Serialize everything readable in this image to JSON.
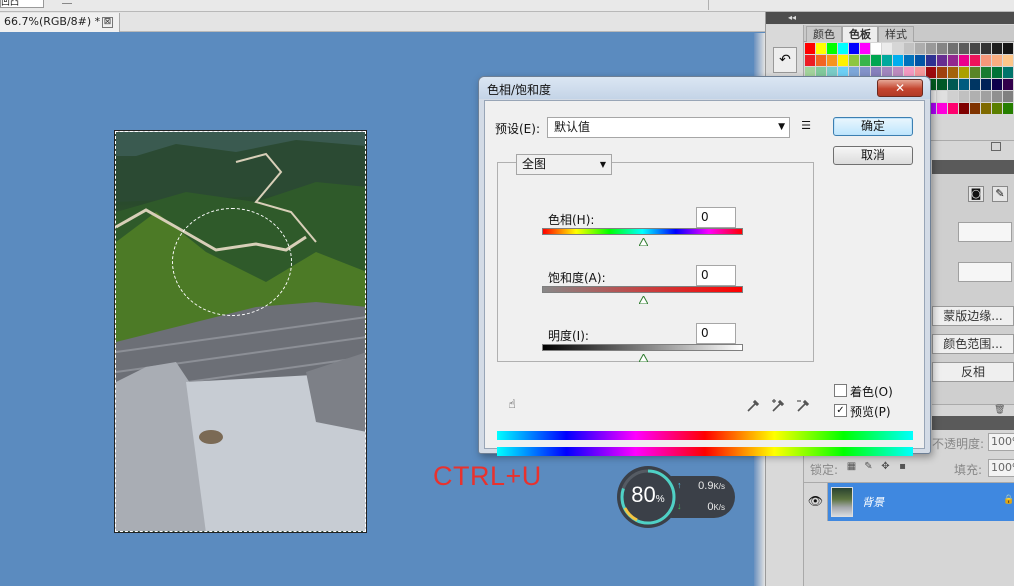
{
  "document_tab": {
    "title": "66.7%(RGB/8#) *",
    "close_glyph": "⊠",
    "top_fragment": "凹凸"
  },
  "annotation": {
    "text": "CTRL+U",
    "color": "#e8322e"
  },
  "network_widget": {
    "percent": "80",
    "percent_unit": "%",
    "upload": "0.9",
    "upload_unit": "K/s",
    "download": "0",
    "download_unit": "K/s"
  },
  "right_panel": {
    "collapse_glyph": "◂◂",
    "tabs": [
      {
        "label": "颜色"
      },
      {
        "label": "色板"
      },
      {
        "label": "样式"
      }
    ],
    "active_tab": "色板",
    "mask_buttons": [
      {
        "label": "蒙版边缘..."
      },
      {
        "label": "颜色范围..."
      },
      {
        "label": "反相"
      }
    ],
    "layers": {
      "opacity_label": "不透明度:",
      "opacity_value": "100%",
      "lock_label": "锁定:",
      "fill_label": "填充:",
      "fill_value": "100%",
      "layer_name": "背景"
    }
  },
  "dialog": {
    "title": "色相/饱和度",
    "close_glyph": "✕",
    "preset_label": "预设(E):",
    "preset_value": "默认值",
    "ok_label": "确定",
    "cancel_label": "取消",
    "channel_value": "全图",
    "hue_label": "色相(H):",
    "hue_value": "0",
    "saturation_label": "饱和度(A):",
    "saturation_value": "0",
    "lightness_label": "明度(I):",
    "lightness_value": "0",
    "colorize_label": "着色(O)",
    "colorize_checked": false,
    "preview_label": "预览(P)",
    "preview_checked": true
  },
  "colors": {
    "canvas_bg": "#5b8bbf",
    "dialog_close": "#c4452f",
    "layer_selected": "#3f88e0"
  }
}
